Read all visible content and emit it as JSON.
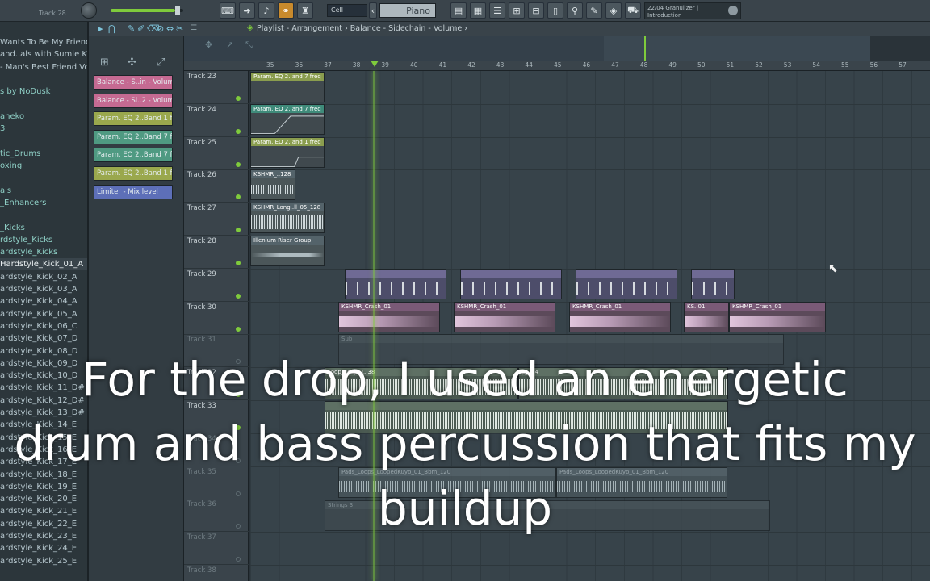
{
  "toolbar": {
    "track_label": "Track 28",
    "snap": "Cell",
    "instrument": "Piano",
    "hint_line1": "22/04  Granulizer |",
    "hint_line2": "Introduction"
  },
  "browser": {
    "items": [
      {
        "label": "Wants To Be My Friend",
        "type": "file"
      },
      {
        "label": "and..als with Sumie Kaneko",
        "type": "file"
      },
      {
        "label": "- Man's Best Friend Vol. 1",
        "type": "file"
      },
      {
        "label": "",
        "type": "file"
      },
      {
        "label": "s by NoDusk",
        "type": "folder"
      },
      {
        "label": "",
        "type": "file"
      },
      {
        "label": "aneko",
        "type": "folder"
      },
      {
        "label": "3",
        "type": "folder"
      },
      {
        "label": "",
        "type": "file"
      },
      {
        "label": "tic_Drums",
        "type": "folder"
      },
      {
        "label": "oxing",
        "type": "folder"
      },
      {
        "label": "",
        "type": "file"
      },
      {
        "label": "als",
        "type": "folder"
      },
      {
        "label": "_Enhancers",
        "type": "folder"
      },
      {
        "label": "",
        "type": "file"
      },
      {
        "label": "_Kicks",
        "type": "folder"
      },
      {
        "label": "rdstyle_Kicks",
        "type": "folder"
      },
      {
        "label": "ardstyle_Kicks",
        "type": "folder"
      },
      {
        "label": "Hardstyle_Kick_01_A",
        "type": "selected"
      },
      {
        "label": "ardstyle_Kick_02_A",
        "type": "file"
      },
      {
        "label": "ardstyle_Kick_03_A",
        "type": "file"
      },
      {
        "label": "ardstyle_Kick_04_A",
        "type": "file"
      },
      {
        "label": "ardstyle_Kick_05_A",
        "type": "file"
      },
      {
        "label": "ardstyle_Kick_06_C",
        "type": "file"
      },
      {
        "label": "ardstyle_Kick_07_D",
        "type": "file"
      },
      {
        "label": "ardstyle_Kick_08_D",
        "type": "file"
      },
      {
        "label": "ardstyle_Kick_09_D",
        "type": "file"
      },
      {
        "label": "ardstyle_Kick_10_D",
        "type": "file"
      },
      {
        "label": "ardstyle_Kick_11_D#",
        "type": "file"
      },
      {
        "label": "ardstyle_Kick_12_D#",
        "type": "file"
      },
      {
        "label": "ardstyle_Kick_13_D#",
        "type": "file"
      },
      {
        "label": "ardstyle_Kick_14_E",
        "type": "file"
      },
      {
        "label": "ardstyle_Kick_15_E",
        "type": "file"
      },
      {
        "label": "ardstyle_Kick_16_E",
        "type": "file"
      },
      {
        "label": "ardstyle_Kick_17_E",
        "type": "file"
      },
      {
        "label": "ardstyle_Kick_18_E",
        "type": "file"
      },
      {
        "label": "ardstyle_Kick_19_E",
        "type": "file"
      },
      {
        "label": "ardstyle_Kick_20_E",
        "type": "file"
      },
      {
        "label": "ardstyle_Kick_21_E",
        "type": "file"
      },
      {
        "label": "ardstyle_Kick_22_E",
        "type": "file"
      },
      {
        "label": "ardstyle_Kick_23_E",
        "type": "file"
      },
      {
        "label": "ardstyle_Kick_24_E",
        "type": "file"
      },
      {
        "label": "ardstyle_Kick_25_E",
        "type": "file"
      }
    ]
  },
  "channels": [
    {
      "label": "Balance - S..in - Volume",
      "color": "#c56a92"
    },
    {
      "label": "Balance - Si..2 - Volume",
      "color": "#c56a92"
    },
    {
      "label": "Param. EQ 2..Band 1 freq",
      "color": "#9aa84d"
    },
    {
      "label": "Param. EQ 2..Band 7 freq",
      "color": "#4f9a82"
    },
    {
      "label": "Param. EQ 2..Band 7 freq",
      "color": "#4f9a82"
    },
    {
      "label": "Param. EQ 2..Band 1 freq",
      "color": "#9aa84d"
    },
    {
      "label": "Limiter - Mix level",
      "color": "#5d6fb8"
    }
  ],
  "playlist": {
    "breadcrumb": "Playlist - Arrangement  ›  Balance - Sidechain - Volume  ›",
    "bars": [
      "35",
      "36",
      "37",
      "38",
      "39",
      "40",
      "41",
      "42",
      "43",
      "44",
      "45",
      "46",
      "47",
      "48",
      "49",
      "50",
      "51",
      "52",
      "53",
      "54",
      "55",
      "56",
      "57"
    ],
    "tracks": [
      {
        "label": "Track 23",
        "dim": false
      },
      {
        "label": "Track 24",
        "dim": false
      },
      {
        "label": "Track 25",
        "dim": false
      },
      {
        "label": "Track 26",
        "dim": false
      },
      {
        "label": "Track 27",
        "dim": false
      },
      {
        "label": "Track 28",
        "dim": false
      },
      {
        "label": "Track 29",
        "dim": false
      },
      {
        "label": "Track 30",
        "dim": false
      },
      {
        "label": "Track 31",
        "dim": true
      },
      {
        "label": "Track 32",
        "dim": false
      },
      {
        "label": "Track 33",
        "dim": false
      },
      {
        "label": "Track 34",
        "dim": true
      },
      {
        "label": "Track 35",
        "dim": true
      },
      {
        "label": "Track 36",
        "dim": true
      },
      {
        "label": "Track 37",
        "dim": true
      },
      {
        "label": "Track 38",
        "dim": true
      }
    ],
    "clips": {
      "t23": "Param. EQ 2..and 7 freq",
      "t24": "Param. EQ 2..and 7 freq",
      "t25": "Param. EQ 2..and 1 freq",
      "t26": "KSHMR_..128",
      "t27": "KSHMR_Long..ll_05_128",
      "t28": "Illenium Riser Group",
      "t30a": "KSHMR_Crash_01",
      "t30b": "KSHMR_Crash_01",
      "t30c": "KSHMR_Crash_01",
      "t30d": "KS..01",
      "t30e": "KSHMR_Crash_01",
      "t31": "Sub",
      "t32a": "Loop_Loop_1..38",
      "t32b": "p_174",
      "t35a": "Pads_Loops_LoopedKuyo_01_Bbm_120",
      "t35b": "Pads_Loops_LoopedKuyo_01_Bbm_120",
      "t36": "Strings 3"
    }
  },
  "subtitle": {
    "line1": "For the drop, I used an energetic",
    "line2": "drum and bass percussion that fits my",
    "line3": "buildup"
  }
}
